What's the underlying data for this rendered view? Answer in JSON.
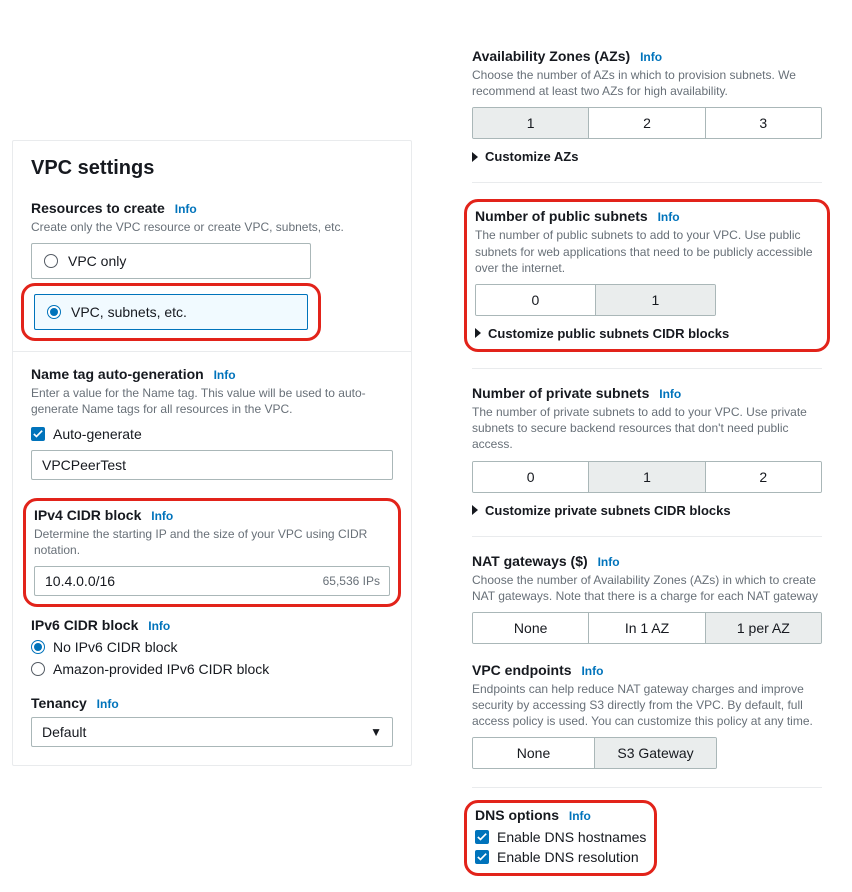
{
  "left": {
    "panel_title": "VPC settings",
    "resources": {
      "label": "Resources to create",
      "info": "Info",
      "help": "Create only the VPC resource or create VPC, subnets, etc.",
      "opt_vpc_only": "VPC only",
      "opt_vpc_subnets": "VPC, subnets, etc."
    },
    "name_tag": {
      "label": "Name tag auto-generation",
      "info": "Info",
      "help": "Enter a value for the Name tag. This value will be used to auto-generate Name tags for all resources in the VPC.",
      "auto_gen_label": "Auto-generate",
      "name_value": "VPCPeerTest"
    },
    "ipv4": {
      "label": "IPv4 CIDR block",
      "info": "Info",
      "help": "Determine the starting IP and the size of your VPC using CIDR notation.",
      "value": "10.4.0.0/16",
      "count": "65,536 IPs"
    },
    "ipv6": {
      "label": "IPv6 CIDR block",
      "info": "Info",
      "opt_none": "No IPv6 CIDR block",
      "opt_aws": "Amazon-provided IPv6 CIDR block"
    },
    "tenancy": {
      "label": "Tenancy",
      "info": "Info",
      "value": "Default"
    }
  },
  "right": {
    "azs": {
      "label": "Availability Zones (AZs)",
      "info": "Info",
      "help": "Choose the number of AZs in which to provision subnets. We recommend at least two AZs for high availability.",
      "opts": [
        "1",
        "2",
        "3"
      ],
      "expander": "Customize AZs"
    },
    "pub": {
      "label": "Number of public subnets",
      "info": "Info",
      "help": "The number of public subnets to add to your VPC. Use public subnets for web applications that need to be publicly accessible over the internet.",
      "opts": [
        "0",
        "1"
      ],
      "expander": "Customize public subnets CIDR blocks"
    },
    "priv": {
      "label": "Number of private subnets",
      "info": "Info",
      "help": "The number of private subnets to add to your VPC. Use private subnets to secure backend resources that don't need public access.",
      "opts": [
        "0",
        "1",
        "2"
      ],
      "expander": "Customize private subnets CIDR blocks"
    },
    "nat": {
      "label": "NAT gateways ($)",
      "info": "Info",
      "help": "Choose the number of Availability Zones (AZs) in which to create NAT gateways. Note that there is a charge for each NAT gateway",
      "opts": [
        "None",
        "In 1 AZ",
        "1 per AZ"
      ]
    },
    "vpce": {
      "label": "VPC endpoints",
      "info": "Info",
      "help": "Endpoints can help reduce NAT gateway charges and improve security by accessing S3 directly from the VPC. By default, full access policy is used. You can customize this policy at any time.",
      "opts": [
        "None",
        "S3 Gateway"
      ]
    },
    "dns": {
      "label": "DNS options",
      "info": "Info",
      "hostnames": "Enable DNS hostnames",
      "resolution": "Enable DNS resolution"
    }
  }
}
